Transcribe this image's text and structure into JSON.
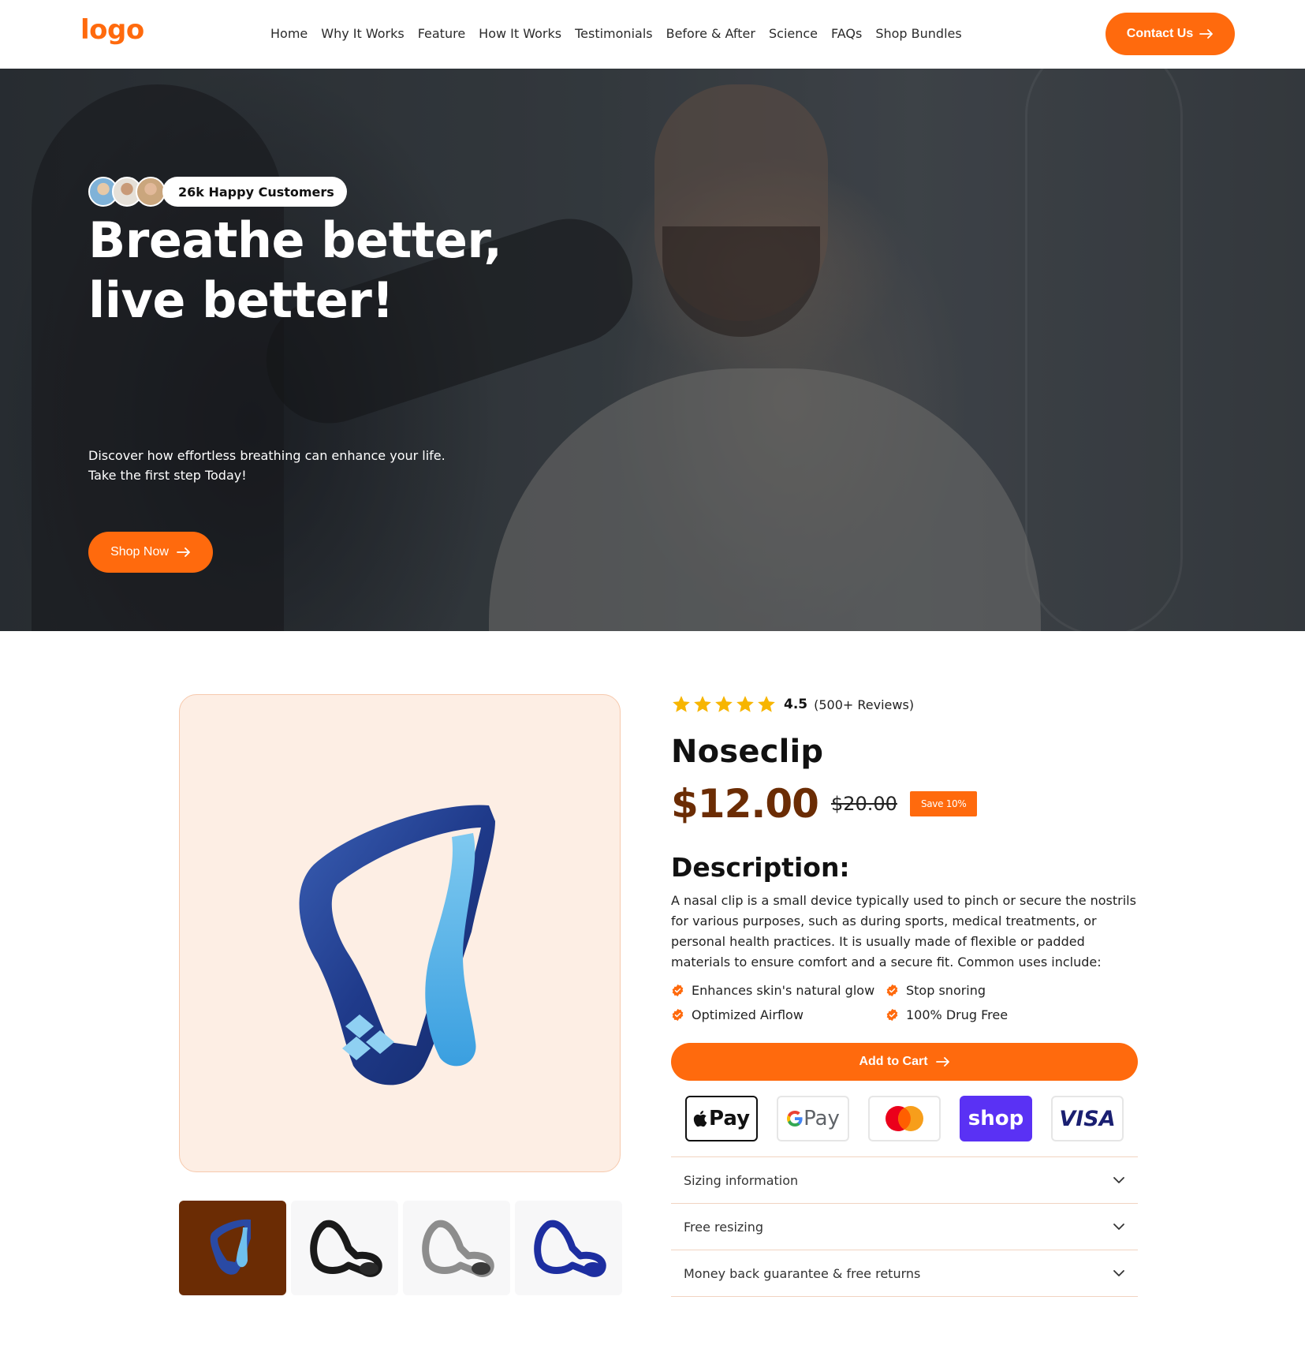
{
  "header": {
    "logo": "logo",
    "nav": [
      "Home",
      "Why It Works",
      "Feature",
      "How It Works",
      "Testimonials",
      "Before & After",
      "Science",
      "FAQs",
      "Shop Bundles"
    ],
    "contact_label": "Contact Us"
  },
  "hero": {
    "customers_label": "26k Happy Customers",
    "title_line1": "Breathe better,",
    "title_line2": "live better!",
    "subtitle_line1": "Discover how effortless breathing can enhance your life.",
    "subtitle_line2": "Take the first step Today!",
    "shop_label": "Shop Now"
  },
  "product": {
    "rating_value": "4.5",
    "rating_stars": 5,
    "rating_count": "(500+ Reviews)",
    "name": "Noseclip",
    "price": "$12.00",
    "old_price": "$20.00",
    "save_badge": "Save 10%",
    "description_title": "Description:",
    "description": "A nasal clip is a small device typically used to pinch or secure the nostrils for various purposes, such as during sports, medical treatments, or personal health practices. It is usually made of flexible or padded materials to ensure comfort and a secure fit. Common uses include:",
    "benefits": [
      "Enhances skin's natural glow",
      "Stop snoring",
      "Optimized Airflow",
      "100% Drug Free"
    ],
    "add_to_cart": "Add to Cart",
    "payments": {
      "apple": "Pay",
      "google": "Pay",
      "shop": "shop",
      "visa": "VISA"
    },
    "accordion": [
      "Sizing information",
      "Free resizing",
      "Money back guarantee & free returns"
    ]
  },
  "colors": {
    "accent": "#ff6a0d",
    "price": "#6b2c04",
    "image_bg": "#fdeee4"
  }
}
